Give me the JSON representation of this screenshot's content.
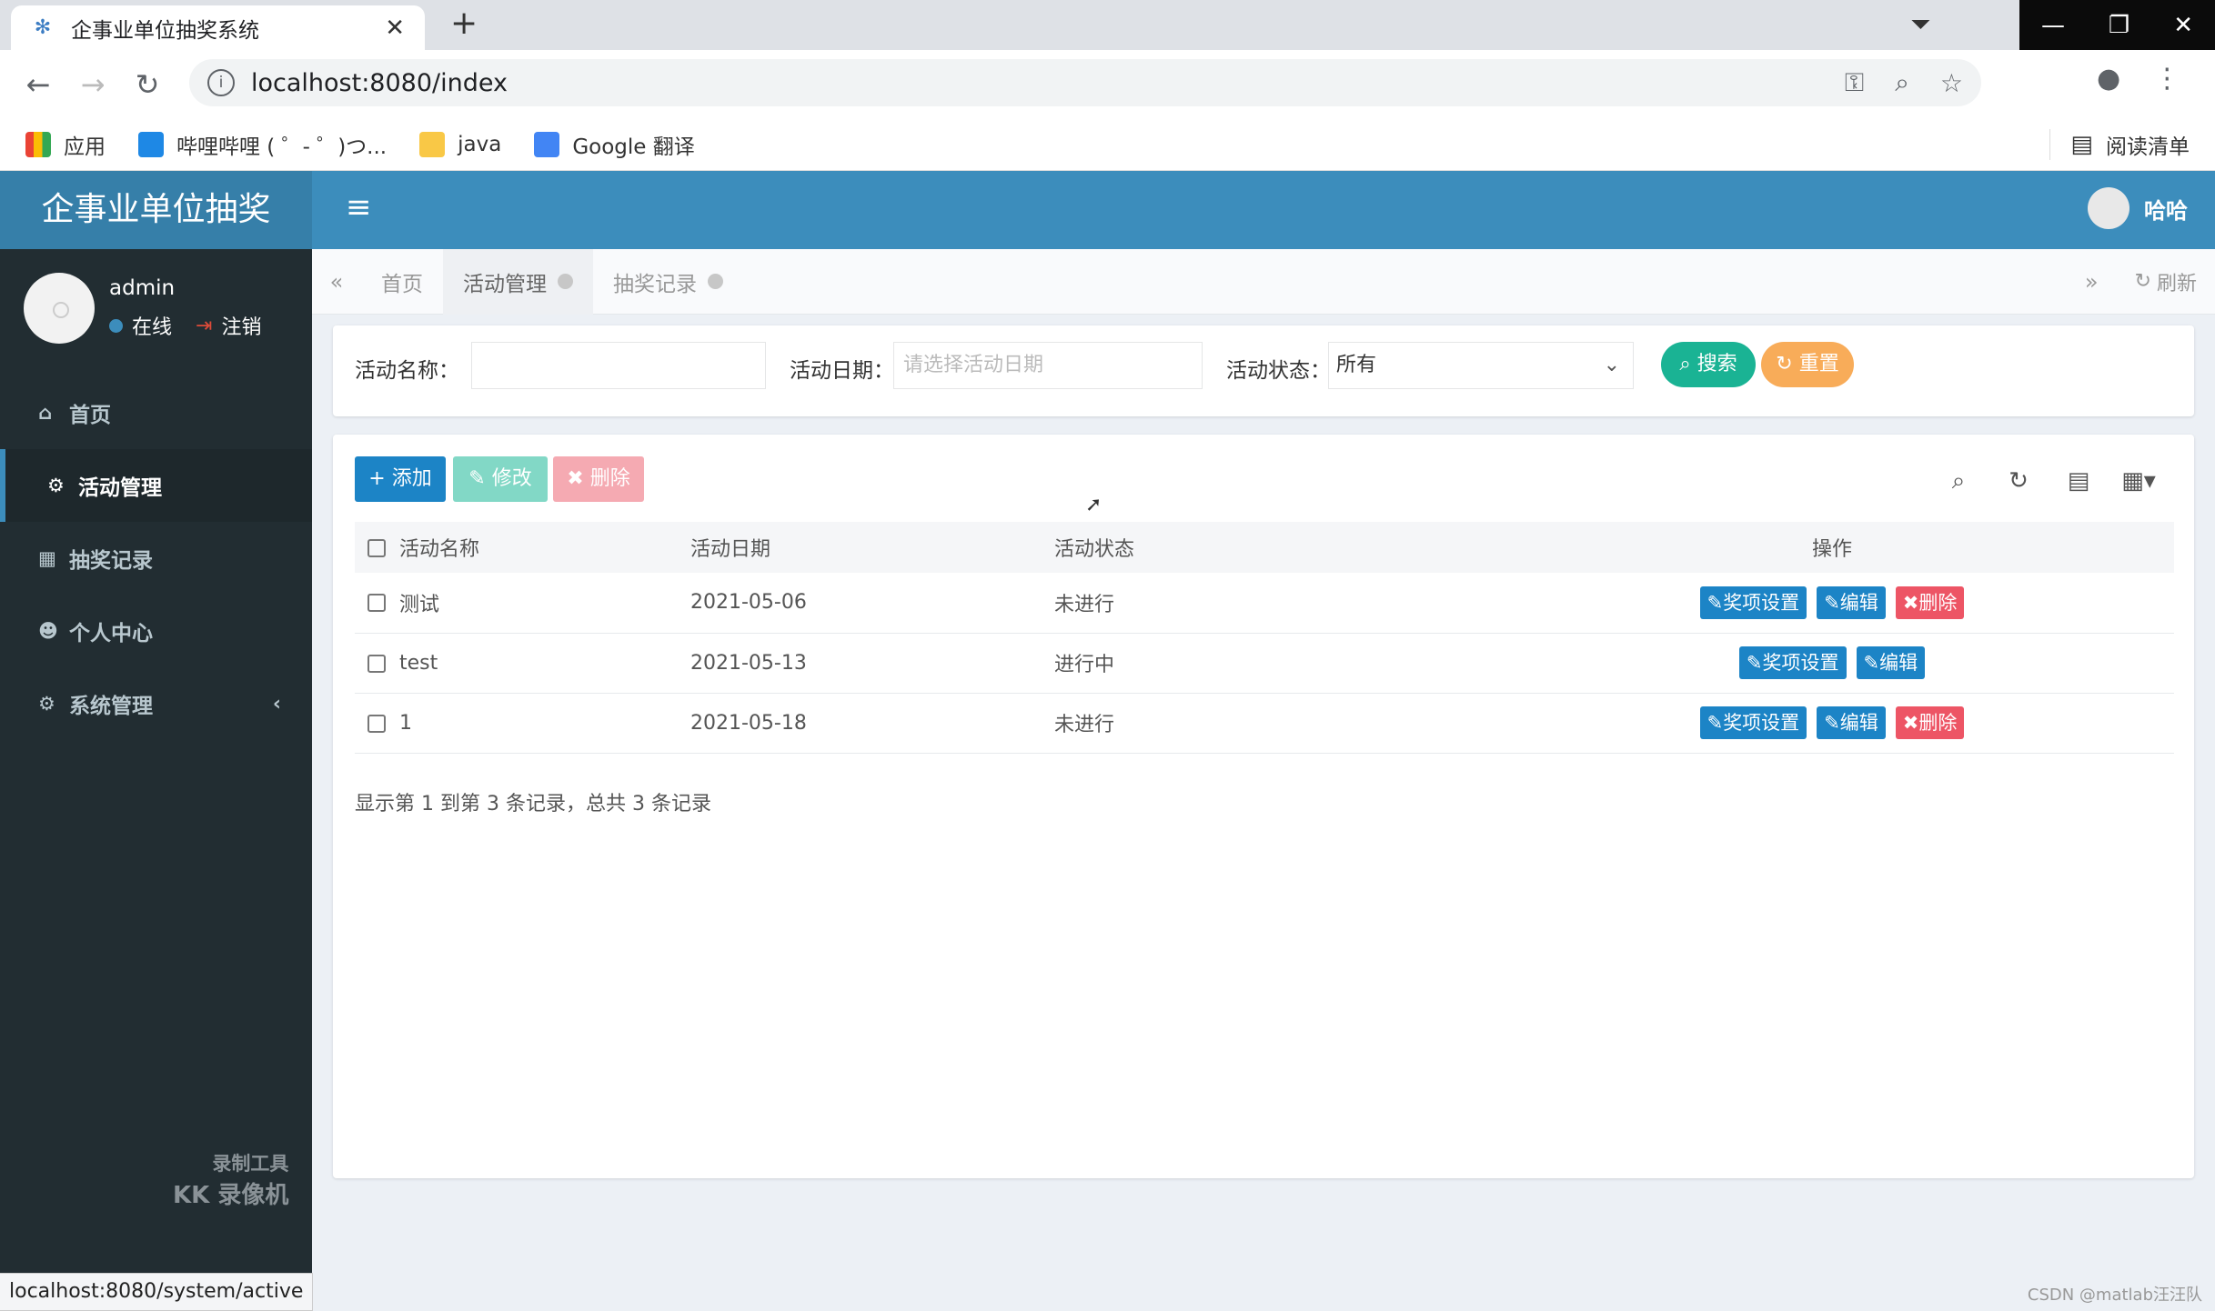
{
  "browser": {
    "tab_title": "企事业单位抽奖系统",
    "tab_close": "✕",
    "new_tab": "+",
    "url": "localhost:8080/index",
    "bookmarks": [
      {
        "label": "应用"
      },
      {
        "label": "哔哩哔哩 ( ゜- ゜)つ..."
      },
      {
        "label": "java"
      },
      {
        "label": "Google 翻译"
      }
    ],
    "reading_list": "阅读清单",
    "status_url": "localhost:8080/system/active"
  },
  "header": {
    "logo": "企事业单位抽奖",
    "user_name": "哈哈"
  },
  "sidebar": {
    "user": "admin",
    "online": "在线",
    "logout": "注销",
    "items": [
      {
        "label": "首页",
        "icon": "home-icon"
      },
      {
        "label": "活动管理",
        "icon": "cogs-icon"
      },
      {
        "label": "抽奖记录",
        "icon": "calendar-icon"
      },
      {
        "label": "个人中心",
        "icon": "users-icon"
      },
      {
        "label": "系统管理",
        "icon": "gear-icon"
      }
    ],
    "watermark_line1": "录制工具",
    "watermark_line2": "KK 录像机"
  },
  "content_tabs": {
    "items": [
      {
        "label": "首页"
      },
      {
        "label": "活动管理"
      },
      {
        "label": "抽奖记录"
      }
    ],
    "refresh": "刷新"
  },
  "search": {
    "name_label": "活动名称：",
    "name_value": "",
    "date_label": "活动日期：",
    "date_placeholder": "请选择活动日期",
    "status_label": "活动状态：",
    "status_value": "所有",
    "search_btn": "搜索",
    "reset_btn": "重置"
  },
  "toolbar": {
    "add": "添加",
    "edit": "修改",
    "delete": "删除"
  },
  "table": {
    "columns": [
      "活动名称",
      "活动日期",
      "活动状态",
      "操作"
    ],
    "rows": [
      {
        "name": "测试",
        "date": "2021-05-06",
        "status": "未进行",
        "deletable": true
      },
      {
        "name": "test",
        "date": "2021-05-13",
        "status": "进行中",
        "deletable": false
      },
      {
        "name": "1",
        "date": "2021-05-18",
        "status": "未进行",
        "deletable": true
      }
    ],
    "op_prize": "奖项设置",
    "op_edit": "编辑",
    "op_delete": "删除",
    "pager": "显示第 1 到第 3 条记录，总共 3 条记录"
  },
  "watermark": "CSDN @matlab汪汪队",
  "colors": {
    "header": "#3c8dbc",
    "sidebar": "#222d32",
    "primary": "#1c84c6",
    "danger": "#ed5565",
    "success": "#1ab394",
    "warning": "#f8ac59"
  }
}
